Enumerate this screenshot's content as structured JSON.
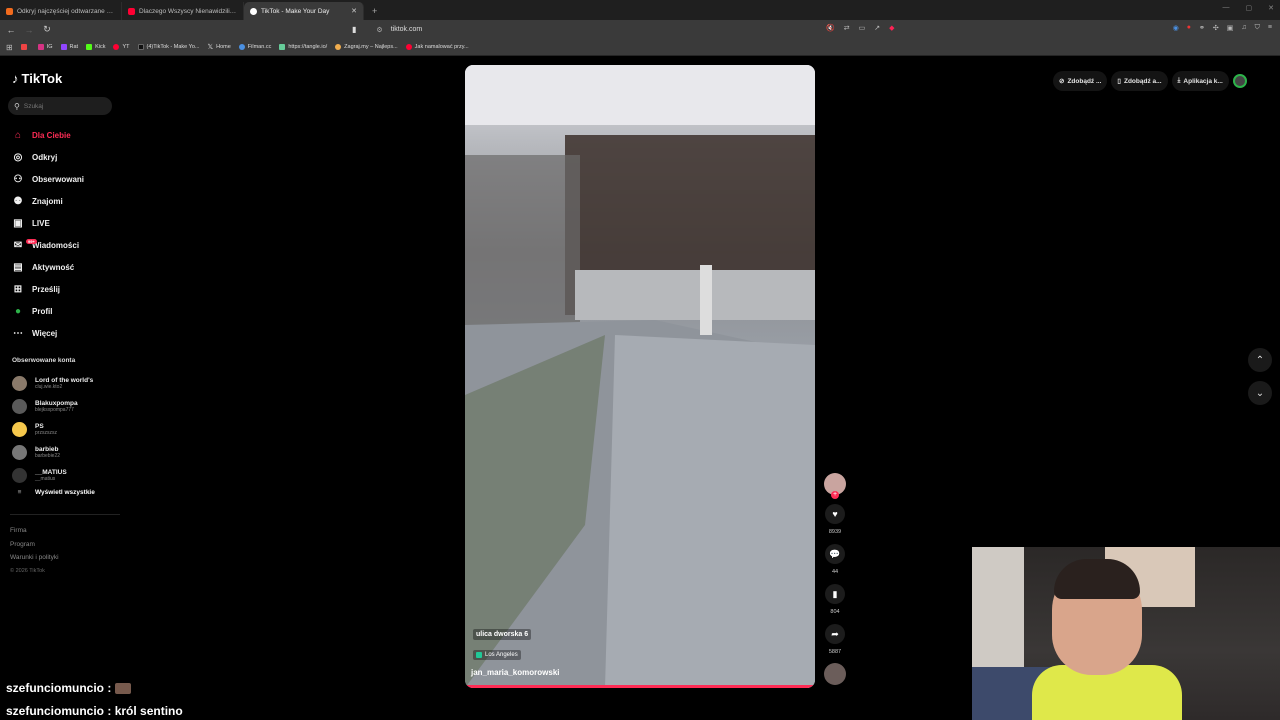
{
  "browser": {
    "tabs": [
      {
        "title": "Odkryj najczęściej odtwarzane utwo...",
        "color": "#f26b1d",
        "active": false
      },
      {
        "title": "Dlaczego Wszyscy Nienawidziliśmy S...",
        "color": "#ff0033",
        "active": false
      },
      {
        "title": "TikTok - Make Your Day",
        "color": "#ffffff",
        "active": true
      }
    ],
    "url": "tiktok.com",
    "bookmarks": [
      {
        "label": "",
        "color": "#e44"
      },
      {
        "label": "IG",
        "color": "#d63384"
      },
      {
        "label": "Rat",
        "color": "#9146ff"
      },
      {
        "label": "Kick",
        "color": "#53fc18"
      },
      {
        "label": "YT",
        "color": "#ff0033"
      },
      {
        "label": "(4)TikTok - Make Yo...",
        "color": "#111"
      },
      {
        "label": "Home",
        "color": "#111"
      },
      {
        "label": "Filman.cc",
        "color": "#4a90e2"
      },
      {
        "label": "https://tangle.io/",
        "color": "#6c9"
      },
      {
        "label": "Zagraj.my – Najleps...",
        "color": "#f0ad4e"
      },
      {
        "label": "Jak namalować przy...",
        "color": "#ff0033"
      }
    ]
  },
  "tiktok": {
    "logo": "TikTok",
    "search_placeholder": "Szukaj",
    "nav": [
      {
        "label": "Dla Ciebie",
        "icon": "home-icon",
        "active": true
      },
      {
        "label": "Odkryj",
        "icon": "compass-icon",
        "active": false
      },
      {
        "label": "Obserwowani",
        "icon": "following-icon",
        "active": false
      },
      {
        "label": "Znajomi",
        "icon": "friends-icon",
        "active": false
      },
      {
        "label": "LIVE",
        "icon": "live-icon",
        "active": false
      },
      {
        "label": "Wiadomości",
        "icon": "messages-icon",
        "active": false,
        "badge": "99+"
      },
      {
        "label": "Aktywność",
        "icon": "activity-icon",
        "active": false
      },
      {
        "label": "Prześlij",
        "icon": "upload-icon",
        "active": false
      },
      {
        "label": "Profil",
        "icon": "profile-icon",
        "active": false
      },
      {
        "label": "Więcej",
        "icon": "more-icon",
        "active": false
      }
    ],
    "followed_title": "Obserwowane konta",
    "followed": [
      {
        "name": "Lord of the world's",
        "user": "cluj.wie.kto2",
        "color": "#8a7a6a"
      },
      {
        "name": "Blakuxpompa",
        "user": "blejksxpompa777",
        "color": "#5a5a5a"
      },
      {
        "name": "PS",
        "user": "przszszsz",
        "color": "#f5c84c"
      },
      {
        "name": "barbieb",
        "user": "barbebie22",
        "color": "#777"
      },
      {
        "name": "__MATIUS",
        "user": "__matius",
        "color": "#333"
      }
    ],
    "show_all": "Wyświetl wszystkie",
    "footer": [
      "Firma",
      "Program",
      "Warunki i polityki"
    ],
    "copyright": "© 2026 TikTok",
    "top_actions": [
      "Zdobądź ...",
      "Zdobądź a...",
      "Aplikacja k..."
    ]
  },
  "video": {
    "location": "ulica dworska 6",
    "tag": "Los Angeles",
    "author": "jan_maria_komorowski",
    "likes": "8939",
    "comments": "44",
    "saves": "804",
    "shares": "5887"
  },
  "chat": [
    {
      "user": "szefunciomuncio",
      "text": ""
    },
    {
      "user": "szefunciomuncio",
      "text": "król sentino"
    }
  ]
}
